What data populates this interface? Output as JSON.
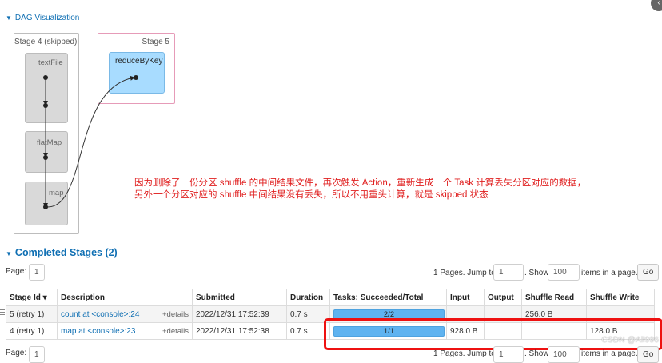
{
  "dag": {
    "toggle_label": "DAG Visualization",
    "stage4_title": "Stage 4 (skipped)",
    "stage5_title": "Stage 5",
    "clusters": [
      "textFile",
      "flatMap",
      "map"
    ],
    "reduce_label": "reduceByKey"
  },
  "annotation": {
    "line1": "因为删除了一份分区 shuffle 的中间结果文件，再次触发 Action，重新生成一个 Task 计算丢失分区对应的数据，",
    "line2": "另外一个分区对应的 shuffle 中间结果没有丢失，所以不用重头计算，就是 skipped 状态"
  },
  "completed": {
    "title": "Completed Stages (2)",
    "page_label": "Page:",
    "page_value": "1",
    "pages_text": "1 Pages. Jump to",
    "jump_value": "1",
    "show_text": ". Show",
    "show_value": "100",
    "items_text": "items in a page.",
    "go_label": "Go",
    "columns": [
      "Stage Id ▾",
      "Description",
      "Submitted",
      "Duration",
      "Tasks: Succeeded/Total",
      "Input",
      "Output",
      "Shuffle Read",
      "Shuffle Write"
    ],
    "rows": [
      {
        "stage_id": "5 (retry 1)",
        "description": "count at <console>:24",
        "details": "+details",
        "submitted": "2022/12/31 17:52:39",
        "duration": "0.7 s",
        "tasks": "2/2",
        "tasks_fraction": 1.0,
        "input": "",
        "output": "",
        "shuffle_read": "256.0 B",
        "shuffle_write": ""
      },
      {
        "stage_id": "4 (retry 1)",
        "description": "map at <console>:23",
        "details": "+details",
        "submitted": "2022/12/31 17:52:38",
        "duration": "0.7 s",
        "tasks": "1/1",
        "tasks_fraction": 1.0,
        "input": "928.0 B",
        "output": "",
        "shuffle_read": "",
        "shuffle_write": "128.0 B"
      }
    ]
  },
  "bottom_pagination": {
    "page_label": "Page:",
    "page_value": "1",
    "pages_text": "1 Pages. Jump to",
    "jump_value": "1",
    "show_text": ". Show",
    "show_value": "100",
    "items_text": "items in a page.",
    "go_label": "Go"
  },
  "watermark": "CSDN @All996",
  "corner_icon": "chevron-left-icon"
}
